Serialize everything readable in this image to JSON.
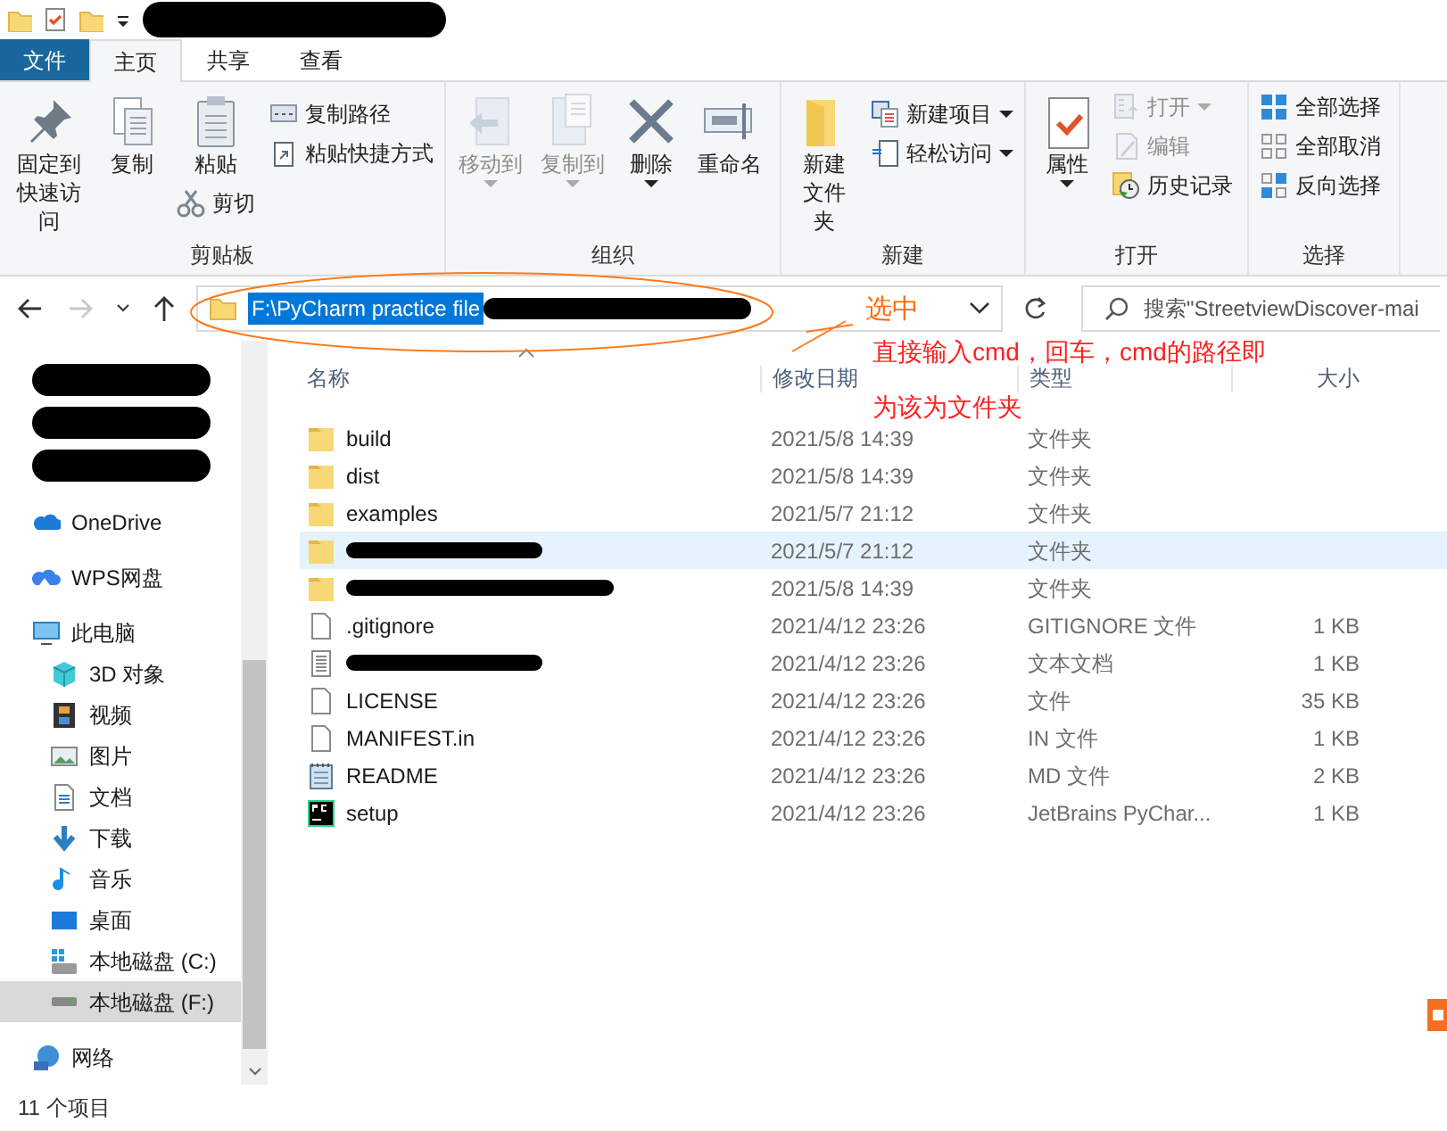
{
  "ribbon_tabs": [
    {
      "label": "文件",
      "kind": "file",
      "selected": false
    },
    {
      "label": "主页",
      "kind": "tab",
      "selected": true
    },
    {
      "label": "共享",
      "kind": "tab",
      "selected": false
    },
    {
      "label": "查看",
      "kind": "tab",
      "selected": false
    }
  ],
  "ribbon_groups": [
    {
      "label": "剪贴板",
      "columns": [
        [
          {
            "label": "固定到快速访问",
            "kind": "large",
            "disabled": false,
            "dropdown": false
          }
        ],
        [
          {
            "label": "复制",
            "kind": "large",
            "disabled": false,
            "dropdown": false
          }
        ],
        [
          {
            "label": "粘贴",
            "kind": "large",
            "disabled": false,
            "dropdown": false
          },
          {
            "label": "剪切",
            "kind": "small",
            "disabled": false,
            "dropdown": false
          }
        ],
        [
          {
            "label": "复制路径",
            "kind": "small",
            "disabled": false,
            "dropdown": false
          },
          {
            "label": "粘贴快捷方式",
            "kind": "small",
            "disabled": false,
            "dropdown": false
          }
        ]
      ]
    },
    {
      "label": "组织",
      "columns": [
        [
          {
            "label": "移动到",
            "kind": "large",
            "disabled": true,
            "dropdown": true
          }
        ],
        [
          {
            "label": "复制到",
            "kind": "large",
            "disabled": true,
            "dropdown": true
          }
        ],
        [
          {
            "label": "删除",
            "kind": "large",
            "disabled": false,
            "dropdown": true
          }
        ],
        [
          {
            "label": "重命名",
            "kind": "large",
            "disabled": false,
            "dropdown": false
          }
        ]
      ]
    },
    {
      "label": "新建",
      "columns": [
        [
          {
            "label": "新建文件夹",
            "kind": "large",
            "disabled": false,
            "dropdown": false
          }
        ],
        [
          {
            "label": "新建项目",
            "kind": "small",
            "disabled": false,
            "dropdown": true
          },
          {
            "label": "轻松访问",
            "kind": "small",
            "disabled": false,
            "dropdown": true
          }
        ]
      ]
    },
    {
      "label": "打开",
      "columns": [
        [
          {
            "label": "属性",
            "kind": "large",
            "disabled": false,
            "dropdown": true
          }
        ],
        [
          {
            "label": "打开",
            "kind": "small",
            "disabled": true,
            "dropdown": true
          },
          {
            "label": "编辑",
            "kind": "small",
            "disabled": true,
            "dropdown": false
          },
          {
            "label": "历史记录",
            "kind": "small",
            "disabled": false,
            "dropdown": false
          }
        ]
      ]
    },
    {
      "label": "选择",
      "columns": [
        [
          {
            "label": "全部选择",
            "kind": "small",
            "disabled": false,
            "dropdown": false
          },
          {
            "label": "全部取消",
            "kind": "small",
            "disabled": false,
            "dropdown": false
          },
          {
            "label": "反向选择",
            "kind": "small",
            "disabled": false,
            "dropdown": false
          }
        ]
      ]
    }
  ],
  "navigation": {
    "forward_disabled": true
  },
  "address": {
    "value": "F:\\PyCharm practice file",
    "selected": true
  },
  "search": {
    "placeholder": "搜索\"StreetviewDiscover-mai"
  },
  "sidebar": {
    "items": [
      {
        "kind": "redacted"
      },
      {
        "kind": "redacted"
      },
      {
        "kind": "redacted"
      },
      {
        "kind": "onedrive",
        "label": "OneDrive",
        "selected": false
      },
      {
        "kind": "wps",
        "label": "WPS网盘",
        "selected": false
      },
      {
        "kind": "pc",
        "label": "此电脑",
        "selected": false,
        "children": [
          {
            "kind": "objects",
            "label": "3D 对象",
            "selected": false
          },
          {
            "kind": "video",
            "label": "视频",
            "selected": false
          },
          {
            "kind": "picture",
            "label": "图片",
            "selected": false
          },
          {
            "kind": "document",
            "label": "文档",
            "selected": false
          },
          {
            "kind": "download",
            "label": "下载",
            "selected": false
          },
          {
            "kind": "music",
            "label": "音乐",
            "selected": false
          },
          {
            "kind": "desktop",
            "label": "桌面",
            "selected": false
          },
          {
            "kind": "sysdrive",
            "label": "本地磁盘 (C:)",
            "selected": false
          },
          {
            "kind": "drive",
            "label": "本地磁盘 (F:)",
            "selected": true
          }
        ]
      },
      {
        "kind": "network",
        "label": "网络",
        "selected": false
      }
    ]
  },
  "table": {
    "columns": [
      "名称",
      "修改日期",
      "类型",
      "大小"
    ],
    "rows": [
      {
        "kind": "folder",
        "name": "build",
        "date": "2021/5/8 14:39",
        "file_type": "文件夹",
        "size": "",
        "hovered": false
      },
      {
        "kind": "folder",
        "name": "dist",
        "date": "2021/5/8 14:39",
        "file_type": "文件夹",
        "size": "",
        "hovered": false
      },
      {
        "kind": "folder",
        "name": "examples",
        "date": "2021/5/7 21:12",
        "file_type": "文件夹",
        "size": "",
        "hovered": false
      },
      {
        "kind": "folder",
        "name": "",
        "date": "2021/5/7 21:12",
        "file_type": "文件夹",
        "size": "",
        "hovered": true
      },
      {
        "kind": "folder",
        "name": "",
        "date": "2021/5/8 14:39",
        "file_type": "文件夹",
        "size": "",
        "hovered": false
      },
      {
        "kind": "file",
        "name": ".gitignore",
        "date": "2021/4/12 23:26",
        "file_type": "GITIGNORE 文件",
        "size": "1 KB",
        "hovered": false
      },
      {
        "kind": "text",
        "name": "",
        "date": "2021/4/12 23:26",
        "file_type": "文本文档",
        "size": "1 KB",
        "hovered": false
      },
      {
        "kind": "file",
        "name": "LICENSE",
        "date": "2021/4/12 23:26",
        "file_type": "文件",
        "size": "35 KB",
        "hovered": false
      },
      {
        "kind": "file",
        "name": "MANIFEST.in",
        "date": "2021/4/12 23:26",
        "file_type": "IN 文件",
        "size": "1 KB",
        "hovered": false
      },
      {
        "kind": "notepad",
        "name": "README",
        "date": "2021/4/12 23:26",
        "file_type": "MD 文件",
        "size": "2 KB",
        "hovered": false
      },
      {
        "kind": "pycharm",
        "name": "setup",
        "date": "2021/4/12 23:26",
        "file_type": "JetBrains PyChar...",
        "size": "1 KB",
        "hovered": false
      }
    ]
  },
  "status_bar": {
    "text": "11 个项目"
  },
  "annotations": [
    {
      "kind": "label",
      "text": "选中",
      "color": "#ff6a00"
    },
    {
      "kind": "note",
      "text": "直接输入cmd，回车，cmd的路径即",
      "color": "#ff2020"
    },
    {
      "kind": "note2",
      "text": "为该为文件夹",
      "color": "#ff2020"
    }
  ]
}
